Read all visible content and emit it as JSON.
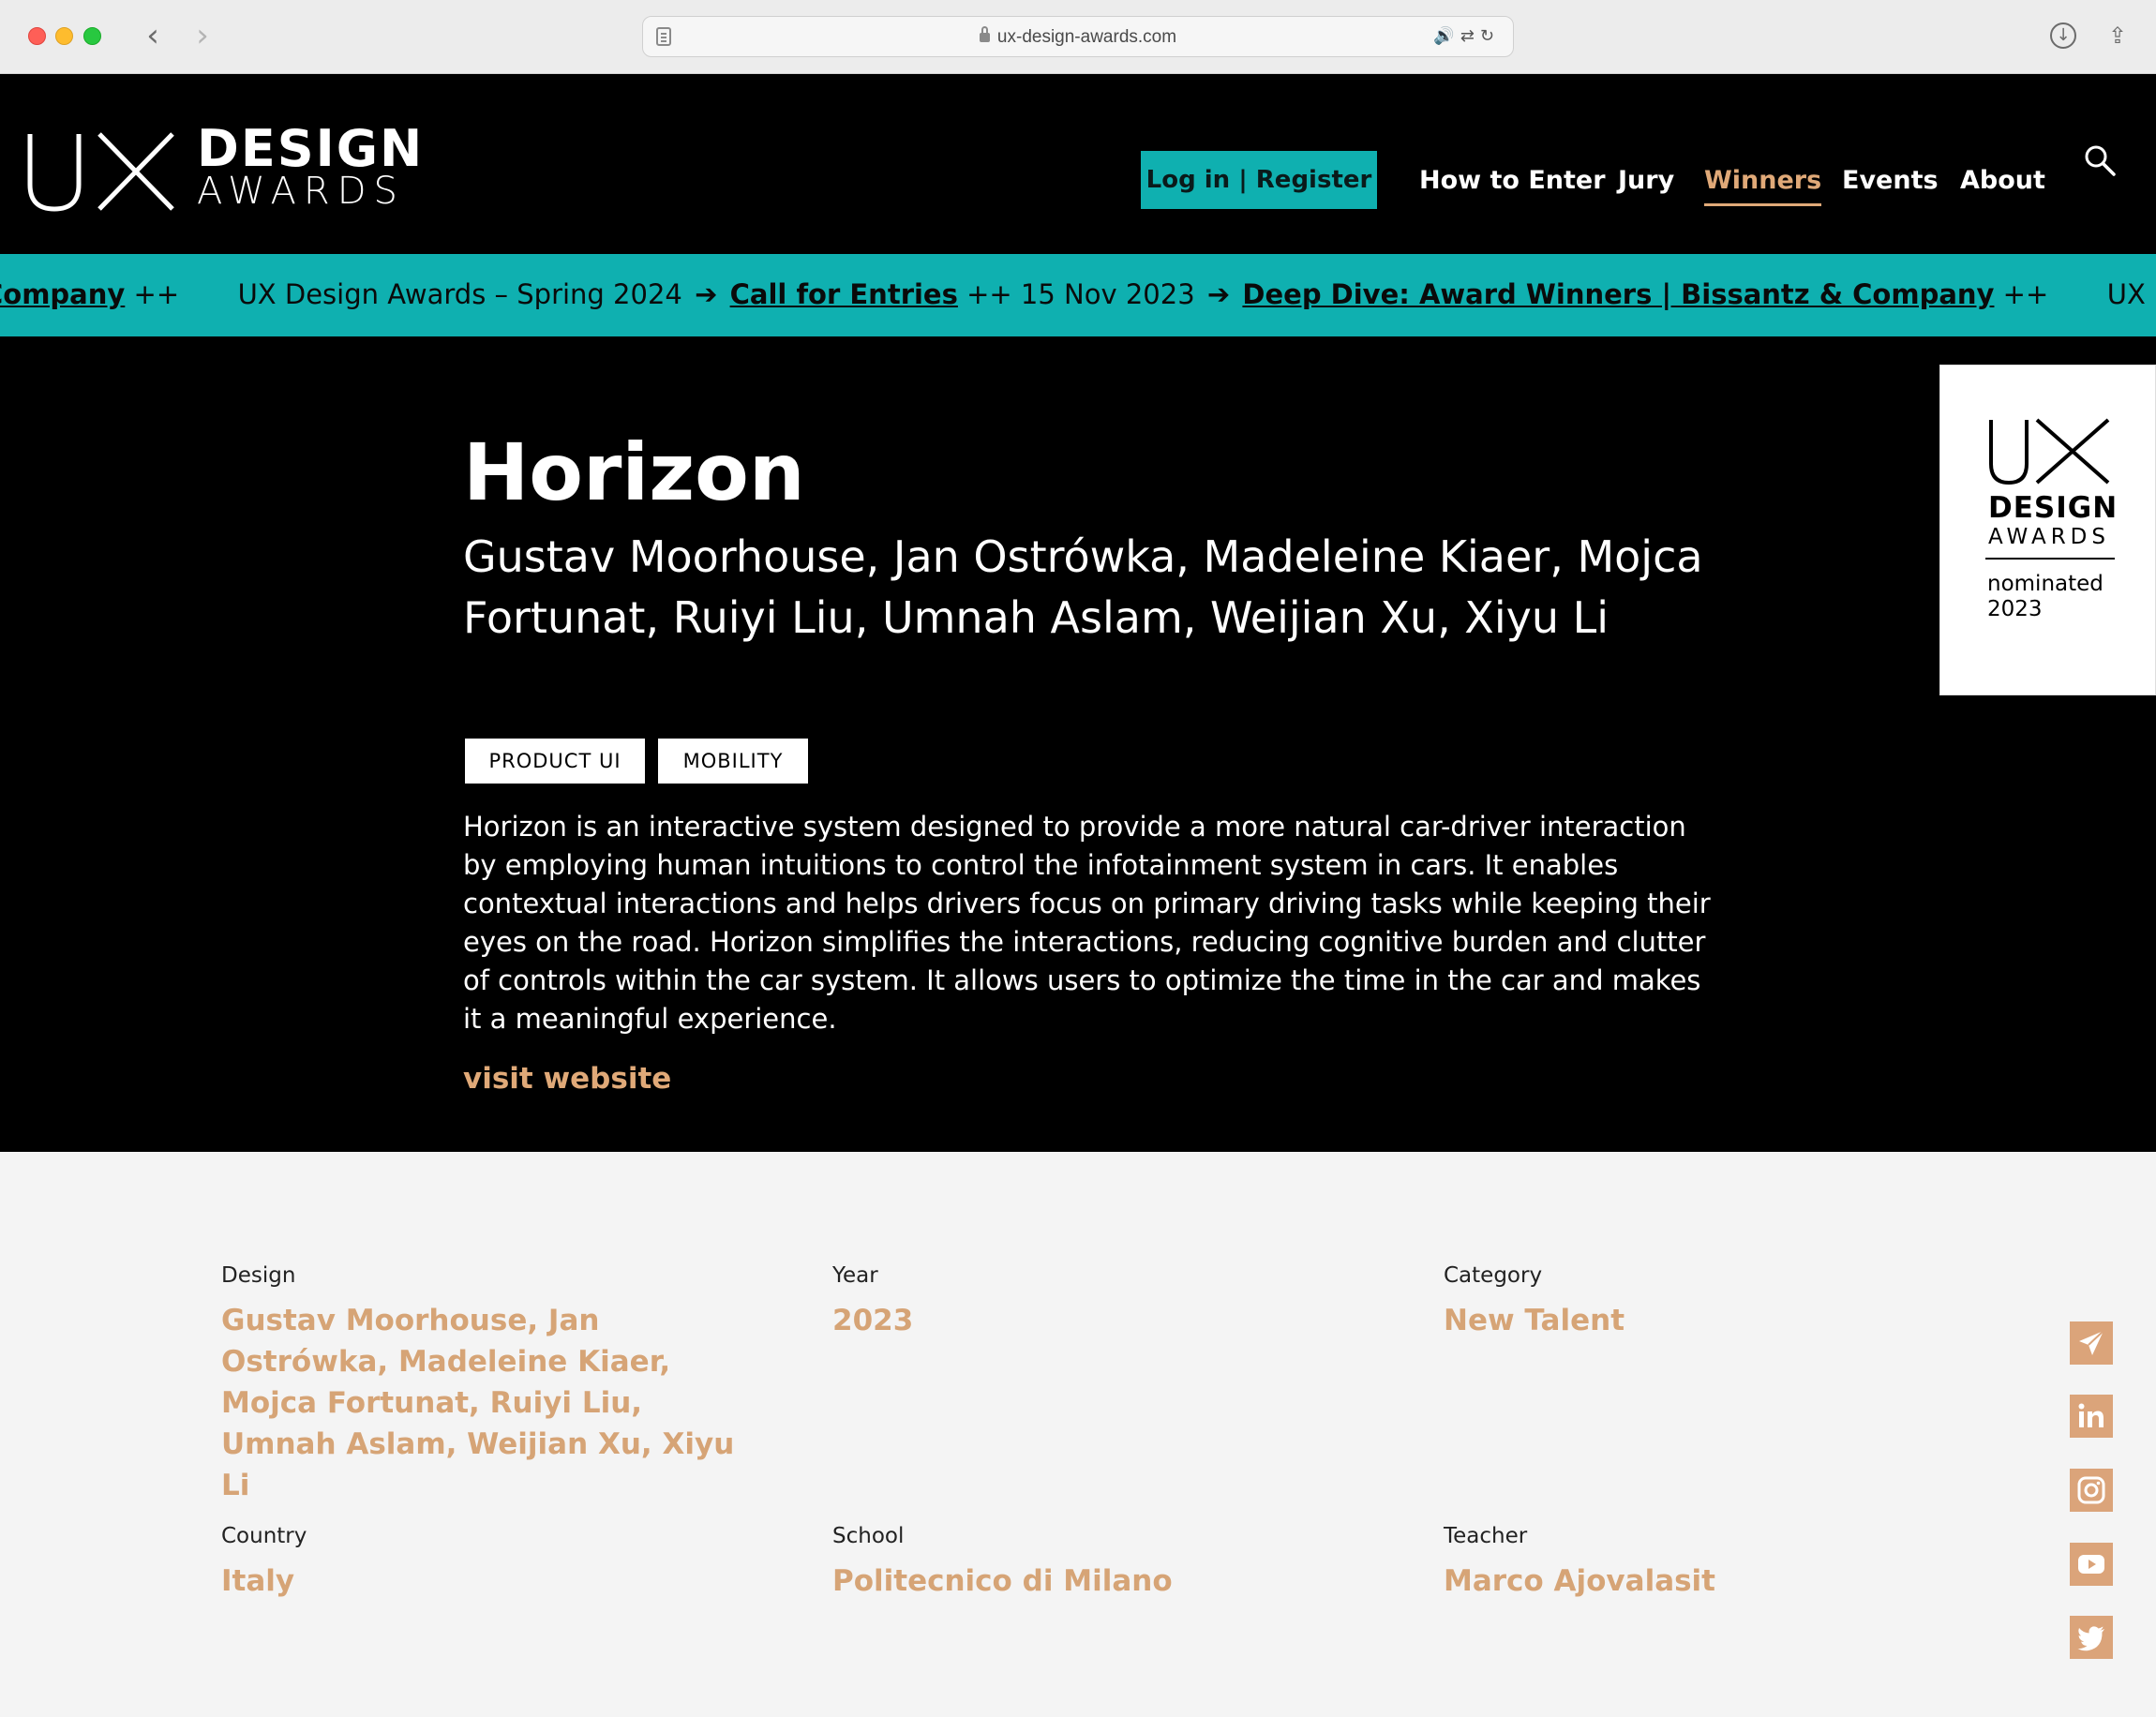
{
  "browser": {
    "url": "ux-design-awards.com"
  },
  "header": {
    "logo": {
      "ux": "UX",
      "design": "DESIGN",
      "awards": "AWARDS"
    },
    "login_label": "Log in | Register",
    "nav": {
      "how_to_enter": "How to Enter",
      "jury": "Jury",
      "winners": "Winners",
      "events": "Events",
      "about": "About"
    },
    "active_nav": "Winners",
    "accent_color": "#0fb0b0",
    "highlight_color": "#e0a978"
  },
  "ticker": {
    "lead_link": "Company",
    "lead_sep": "++",
    "item1_text": "UX Design Awards – Spring 2024",
    "arrow": "➔",
    "item1_link": "Call for Entries",
    "item2_text": "++ 15 Nov 2023",
    "item2_link": "Deep Dive: Award Winners | Bissantz & Company",
    "item2_sep": "++",
    "tail_text": "UX Design Awards – Sp"
  },
  "project": {
    "title": "Horizon",
    "authors": "Gustav Moorhouse, Jan Ostrówka, Madeleine Kiaer, Mojca Fortunat, Ruiyi Liu, Umnah Aslam, Weijian Xu, Xiyu Li",
    "tags": [
      "PRODUCT UI",
      "MOBILITY"
    ],
    "description": "Horizon is an interactive system designed to provide a more natural car-driver interaction by employing human intuitions to control the infotainment system in cars. It enables contextual interactions and helps drivers focus on primary driving tasks while keeping their eyes on the road. Horizon simplifies the interactions, reducing cognitive burden and clutter of controls within the car system. It allows users to optimize the time in the car and makes it a meaningful experience.",
    "visit_label": "visit website"
  },
  "badge": {
    "ux": "UX",
    "design": "DESIGN",
    "awards": "AWARDS",
    "status": "nominated",
    "year": "2023"
  },
  "details": {
    "design": {
      "label": "Design",
      "value": "Gustav Moorhouse, Jan Ostrówka, Madeleine Kiaer, Mojca Fortunat, Ruiyi Liu, Umnah Aslam, Weijian Xu, Xiyu Li"
    },
    "year": {
      "label": "Year",
      "value": "2023"
    },
    "category": {
      "label": "Category",
      "value": "New Talent"
    },
    "country": {
      "label": "Country",
      "value": "Italy"
    },
    "school": {
      "label": "School",
      "value": "Politecnico di Milano"
    },
    "teacher": {
      "label": "Teacher",
      "value": "Marco Ajovalasit"
    }
  },
  "social": [
    "send-icon",
    "linkedin-icon",
    "instagram-icon",
    "youtube-icon",
    "twitter-icon"
  ]
}
